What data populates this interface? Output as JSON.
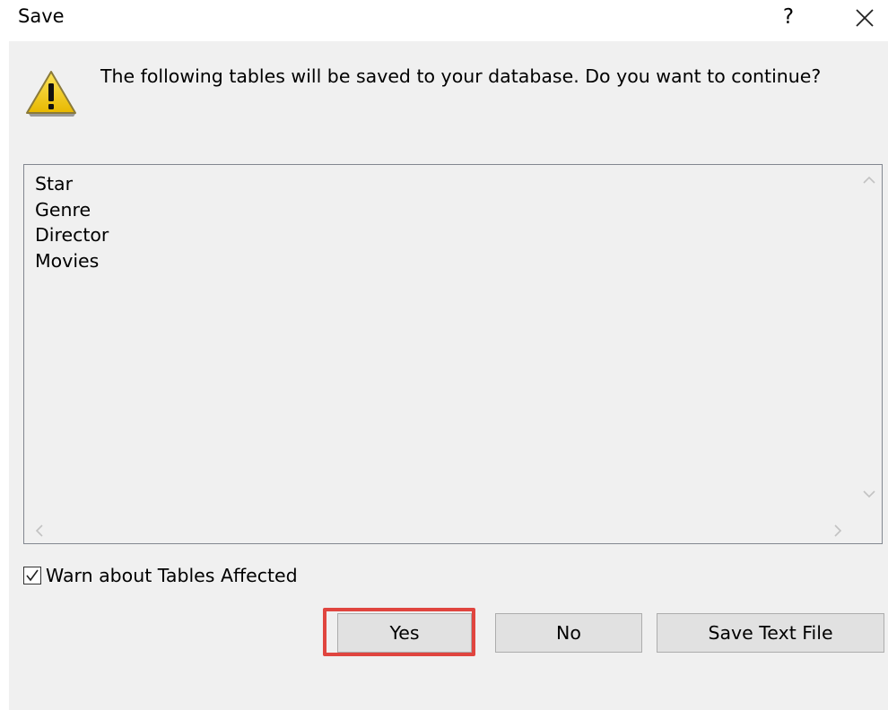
{
  "dialog": {
    "title": "Save",
    "help_label": "?",
    "close_icon": "close-icon"
  },
  "message": {
    "icon": "warning-icon",
    "text": "The following tables will be saved to your database. Do you want to continue?"
  },
  "tables_list": {
    "items": [
      "Star",
      "Genre",
      "Director",
      "Movies"
    ]
  },
  "warn_checkbox": {
    "label": "Warn about Tables Affected",
    "checked": true
  },
  "buttons": {
    "yes": "Yes",
    "no": "No",
    "save_text_file": "Save Text File"
  },
  "colors": {
    "dialog_background": "#f0f0f0",
    "button_face": "#e1e1e1",
    "highlight_border": "#e0453f",
    "warning_yellow": "#f5d20c"
  }
}
